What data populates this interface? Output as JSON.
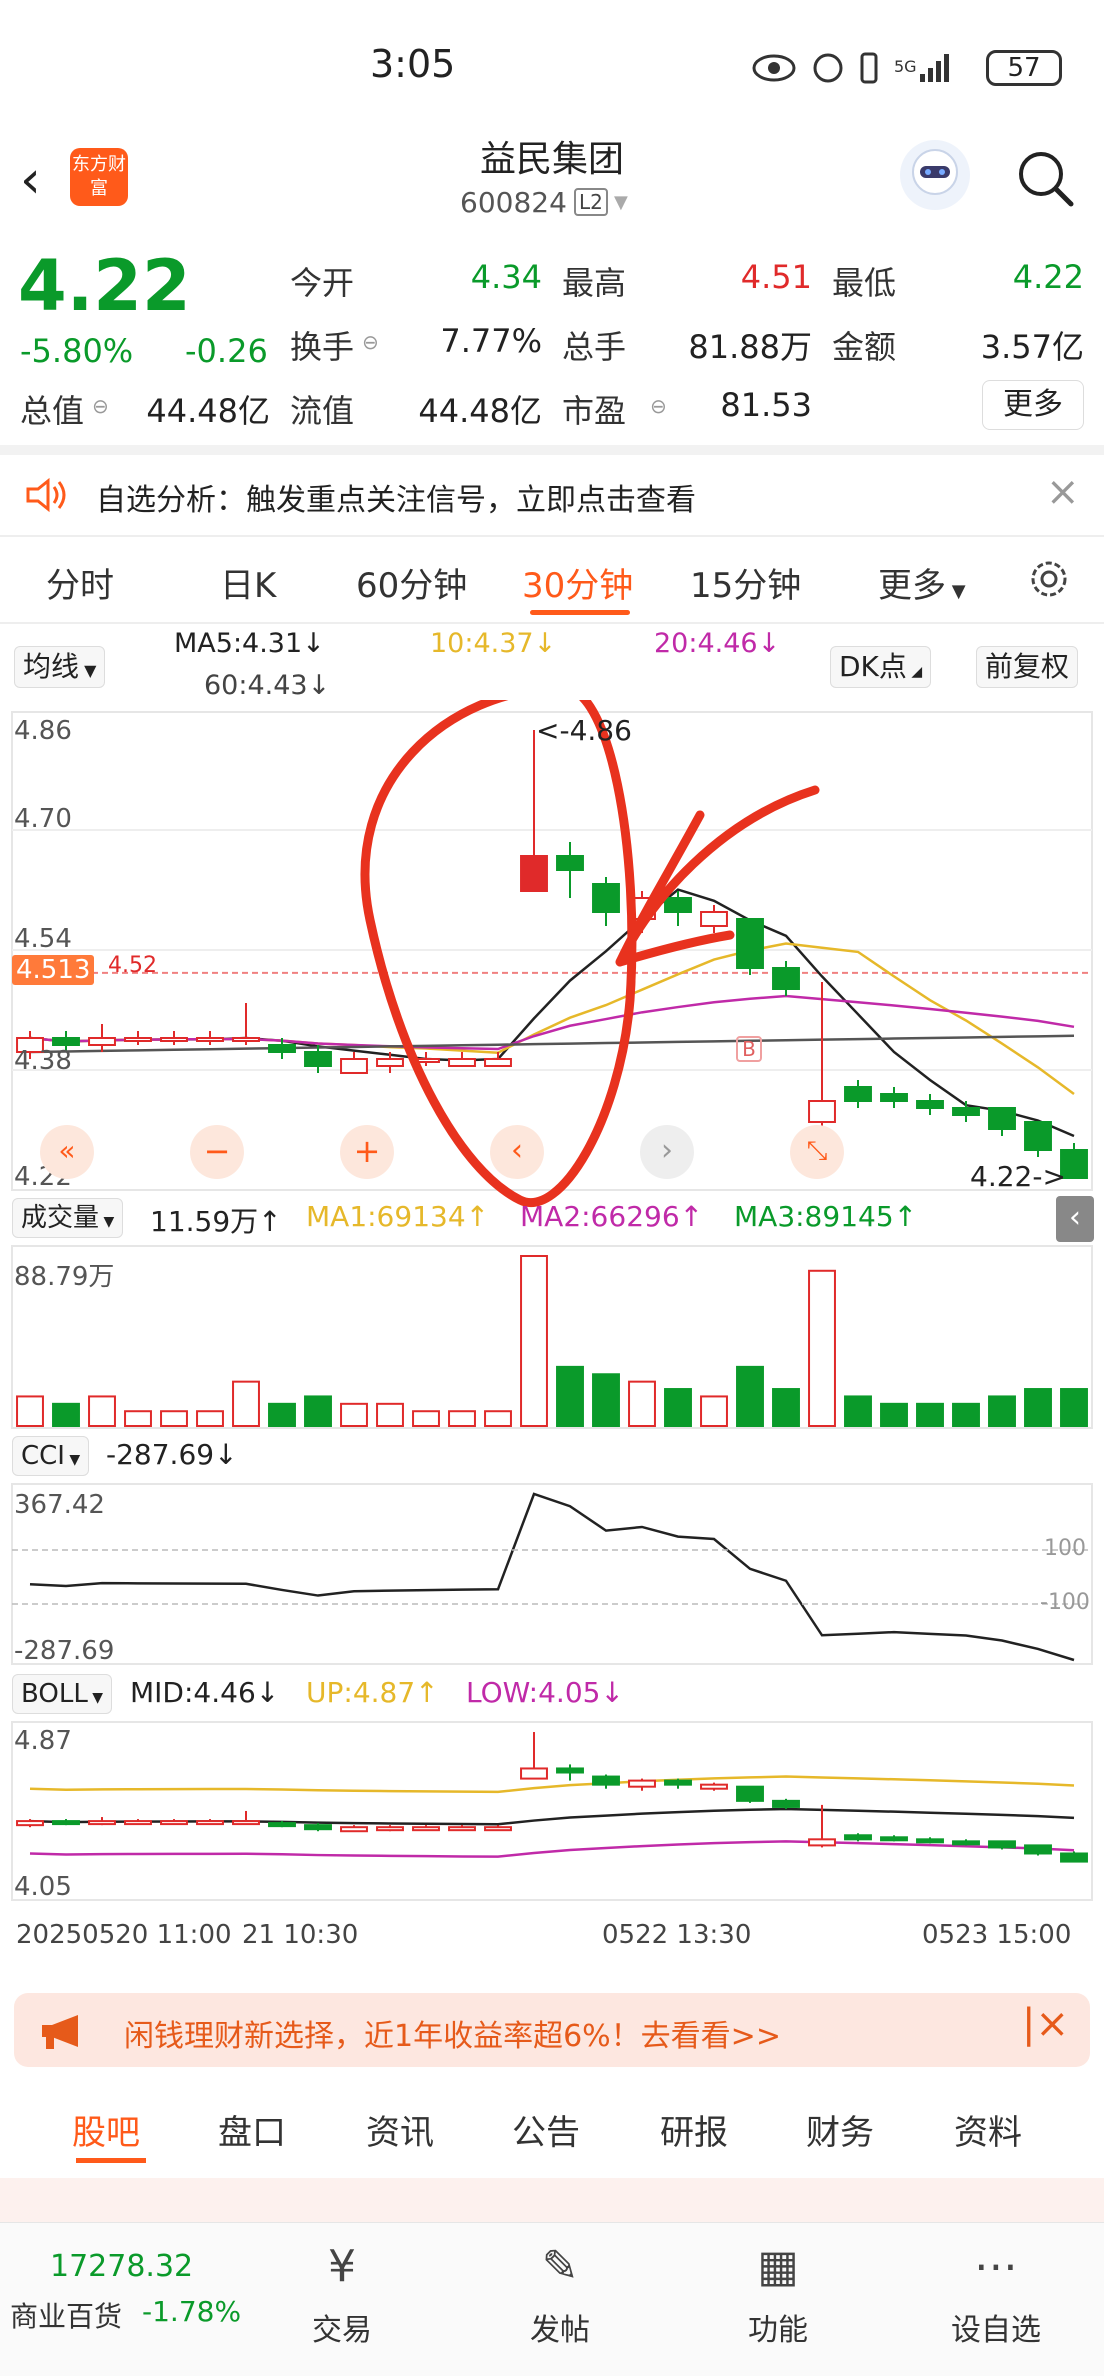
{
  "status_bar": {
    "time": "3:05",
    "battery": "57",
    "network": "5G"
  },
  "header": {
    "title": "益民集团",
    "code": "600824",
    "level_badge": "L2",
    "logo_text": "东方财富"
  },
  "quote": {
    "price": "4.22",
    "change_pct": "-5.80%",
    "change_val": "-0.26",
    "rows": [
      [
        {
          "label": "今开",
          "value": "4.34",
          "color": "green"
        },
        {
          "label": "最高",
          "value": "4.51",
          "color": "red"
        },
        {
          "label": "最低",
          "value": "4.22",
          "color": "green"
        }
      ],
      [
        {
          "label": "换手",
          "value": "7.77%",
          "color": "black"
        },
        {
          "label": "总手",
          "value": "81.88万",
          "color": "black"
        },
        {
          "label": "金额",
          "value": "3.57亿",
          "color": "black"
        }
      ],
      [
        {
          "label": "总值",
          "value": "44.48亿",
          "color": "black"
        },
        {
          "label": "流值",
          "value": "44.48亿",
          "color": "black"
        },
        {
          "label": "市盈",
          "value": "81.53",
          "color": "black"
        }
      ]
    ],
    "more_label": "更多"
  },
  "notice": {
    "text": "自选分析：触发重点关注信号，立即点击查看"
  },
  "tabs": [
    "分时",
    "日K",
    "60分钟",
    "30分钟",
    "15分钟",
    "更多"
  ],
  "active_tab": "30分钟",
  "chart_header": {
    "line_type": "均线",
    "ma5": "MA5:4.31↓",
    "ma10": "10:4.37↓",
    "ma20": "20:4.46↓",
    "ma60": "60:4.43↓",
    "dk": "DK点",
    "fq": "前复权"
  },
  "colors": {
    "accent": "#ff5a1a",
    "up": "#e02a2a",
    "down": "#0a9a2a",
    "ma5": "#222222",
    "ma10": "#e6b82a",
    "ma20": "#c02aa8",
    "ma60": "#555555",
    "annotation": "#e8321e"
  },
  "price_axis": {
    "ticks": [
      "4.86",
      "4.70",
      "4.54",
      "4.38",
      "4.22"
    ],
    "current_tag": "4.513",
    "line_label": "4.52",
    "high_label": "<-4.86",
    "low_label": "4.22->",
    "buy_marker": "B"
  },
  "volume": {
    "label": "成交量",
    "value": "11.59万↑",
    "ma1": "MA1:69134↑",
    "ma2": "MA2:66296↑",
    "ma3": "MA3:89145↑",
    "axis_top": "88.79万"
  },
  "cci": {
    "label": "CCI",
    "value": "-287.69↓",
    "axis_top": "367.42",
    "axis_bottom": "-287.69",
    "ref_hi": "100",
    "ref_lo": "-100"
  },
  "boll": {
    "label": "BOLL",
    "mid": "MID:4.46↓",
    "up": "UP:4.87↑",
    "low": "LOW:4.05↓",
    "axis_top": "4.87",
    "axis_bottom": "4.05"
  },
  "time_axis": {
    "start": "20250520 11:00",
    "t2": "21 10:30",
    "t3": "0522 13:30",
    "t4": "0523 15:00"
  },
  "chart_data": {
    "type": "candlestick",
    "ylim": [
      4.22,
      4.86
    ],
    "candles": [
      {
        "o": 4.4,
        "c": 4.42,
        "h": 4.43,
        "l": 4.39
      },
      {
        "o": 4.42,
        "c": 4.41,
        "h": 4.43,
        "l": 4.4
      },
      {
        "o": 4.41,
        "c": 4.42,
        "h": 4.44,
        "l": 4.4
      },
      {
        "o": 4.42,
        "c": 4.42,
        "h": 4.43,
        "l": 4.41
      },
      {
        "o": 4.42,
        "c": 4.42,
        "h": 4.43,
        "l": 4.41
      },
      {
        "o": 4.42,
        "c": 4.42,
        "h": 4.43,
        "l": 4.41
      },
      {
        "o": 4.42,
        "c": 4.42,
        "h": 4.47,
        "l": 4.41
      },
      {
        "o": 4.41,
        "c": 4.4,
        "h": 4.42,
        "l": 4.39
      },
      {
        "o": 4.4,
        "c": 4.38,
        "h": 4.41,
        "l": 4.37
      },
      {
        "o": 4.37,
        "c": 4.39,
        "h": 4.4,
        "l": 4.37
      },
      {
        "o": 4.38,
        "c": 4.39,
        "h": 4.4,
        "l": 4.37
      },
      {
        "o": 4.39,
        "c": 4.39,
        "h": 4.4,
        "l": 4.38
      },
      {
        "o": 4.38,
        "c": 4.39,
        "h": 4.4,
        "l": 4.38
      },
      {
        "o": 4.38,
        "c": 4.39,
        "h": 4.4,
        "l": 4.38
      },
      {
        "o": 4.63,
        "c": 4.68,
        "h": 4.86,
        "l": 4.63
      },
      {
        "o": 4.68,
        "c": 4.66,
        "h": 4.7,
        "l": 4.62
      },
      {
        "o": 4.64,
        "c": 4.6,
        "h": 4.65,
        "l": 4.58
      },
      {
        "o": 4.59,
        "c": 4.62,
        "h": 4.63,
        "l": 4.57
      },
      {
        "o": 4.62,
        "c": 4.6,
        "h": 4.63,
        "l": 4.58
      },
      {
        "o": 4.58,
        "c": 4.6,
        "h": 4.61,
        "l": 4.57
      },
      {
        "o": 4.59,
        "c": 4.52,
        "h": 4.59,
        "l": 4.51
      },
      {
        "o": 4.52,
        "c": 4.49,
        "h": 4.53,
        "l": 4.48
      },
      {
        "o": 4.3,
        "c": 4.33,
        "h": 4.5,
        "l": 4.29
      },
      {
        "o": 4.35,
        "c": 4.33,
        "h": 4.36,
        "l": 4.32
      },
      {
        "o": 4.34,
        "c": 4.33,
        "h": 4.35,
        "l": 4.32
      },
      {
        "o": 4.33,
        "c": 4.32,
        "h": 4.34,
        "l": 4.31
      },
      {
        "o": 4.32,
        "c": 4.31,
        "h": 4.33,
        "l": 4.3
      },
      {
        "o": 4.32,
        "c": 4.29,
        "h": 4.32,
        "l": 4.28
      },
      {
        "o": 4.3,
        "c": 4.26,
        "h": 4.3,
        "l": 4.25
      },
      {
        "o": 4.26,
        "c": 4.22,
        "h": 4.27,
        "l": 4.22
      }
    ]
  },
  "ad": {
    "text": "闲钱理财新选择，近1年收益率超6%！去看看>>"
  },
  "bottom_tabs": [
    "股吧",
    "盘口",
    "资讯",
    "公告",
    "研报",
    "财务",
    "资料"
  ],
  "footer": {
    "index_value": "17278.32",
    "index_name": "商业百货",
    "index_change": "-1.78%",
    "nav": [
      "交易",
      "发帖",
      "功能",
      "设自选"
    ]
  }
}
